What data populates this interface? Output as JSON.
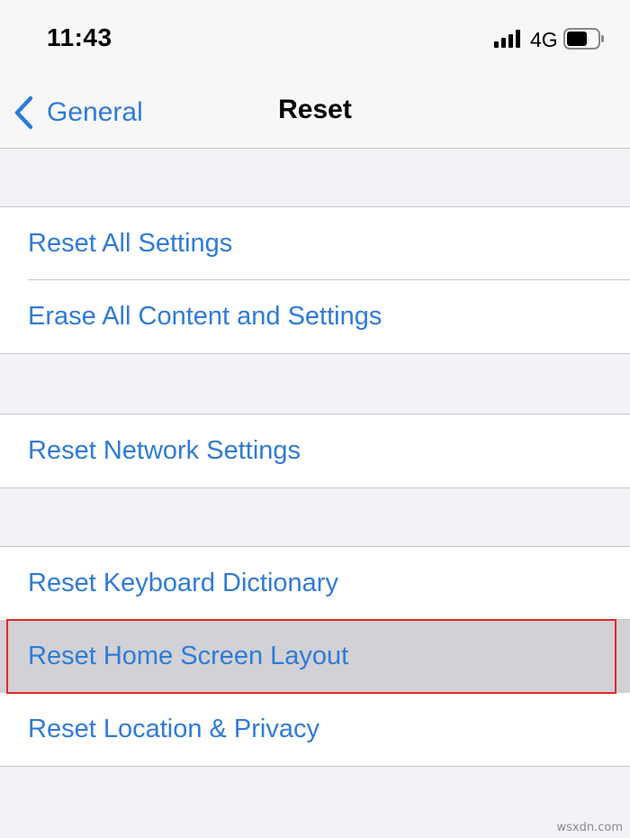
{
  "status_bar": {
    "time": "11:43",
    "network": "4G",
    "signal_icon": "cellular-signal-icon",
    "battery_icon": "battery-icon"
  },
  "nav": {
    "back_label": "General",
    "back_icon": "chevron-left-icon",
    "title": "Reset"
  },
  "groups": [
    {
      "items": [
        {
          "label": "Reset All Settings"
        },
        {
          "label": "Erase All Content and Settings"
        }
      ]
    },
    {
      "items": [
        {
          "label": "Reset Network Settings"
        }
      ]
    },
    {
      "items": [
        {
          "label": "Reset Keyboard Dictionary"
        },
        {
          "label": "Reset Home Screen Layout",
          "highlighted": true
        },
        {
          "label": "Reset Location & Privacy"
        }
      ]
    }
  ],
  "colors": {
    "accent": "#2f7bd6",
    "highlight_border": "#e12a2a",
    "highlight_row": "#d1d1d6",
    "background": "#f2f2f7"
  },
  "watermark": "wsxdn.com"
}
